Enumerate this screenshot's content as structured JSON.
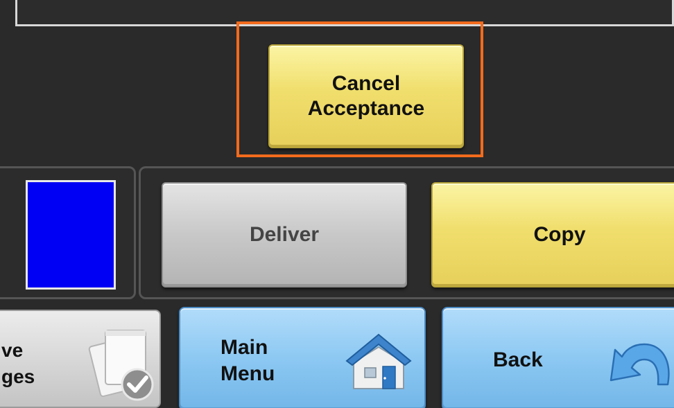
{
  "top_field": {
    "value": ""
  },
  "cancel_button": {
    "line1": "Cancel",
    "line2": "Acceptance"
  },
  "status_swatch": {
    "color": "#0000f5"
  },
  "deliver_button": {
    "label": "Deliver",
    "state": "disabled"
  },
  "copy_button": {
    "label": "Copy"
  },
  "changes_button": {
    "line1": "ve",
    "line2": "ges",
    "icon": "document-check-icon"
  },
  "main_menu_button": {
    "line1": "Main",
    "line2": "Menu",
    "icon": "home-icon"
  },
  "back_button": {
    "label": "Back",
    "icon": "back-arrow-icon"
  },
  "colors": {
    "highlight": "#f26b1d",
    "yellow_button": "#f0de6c",
    "blue_button": "#8cc8f2",
    "gray_button": "#c8c8c8",
    "background": "#2a2a2a"
  }
}
